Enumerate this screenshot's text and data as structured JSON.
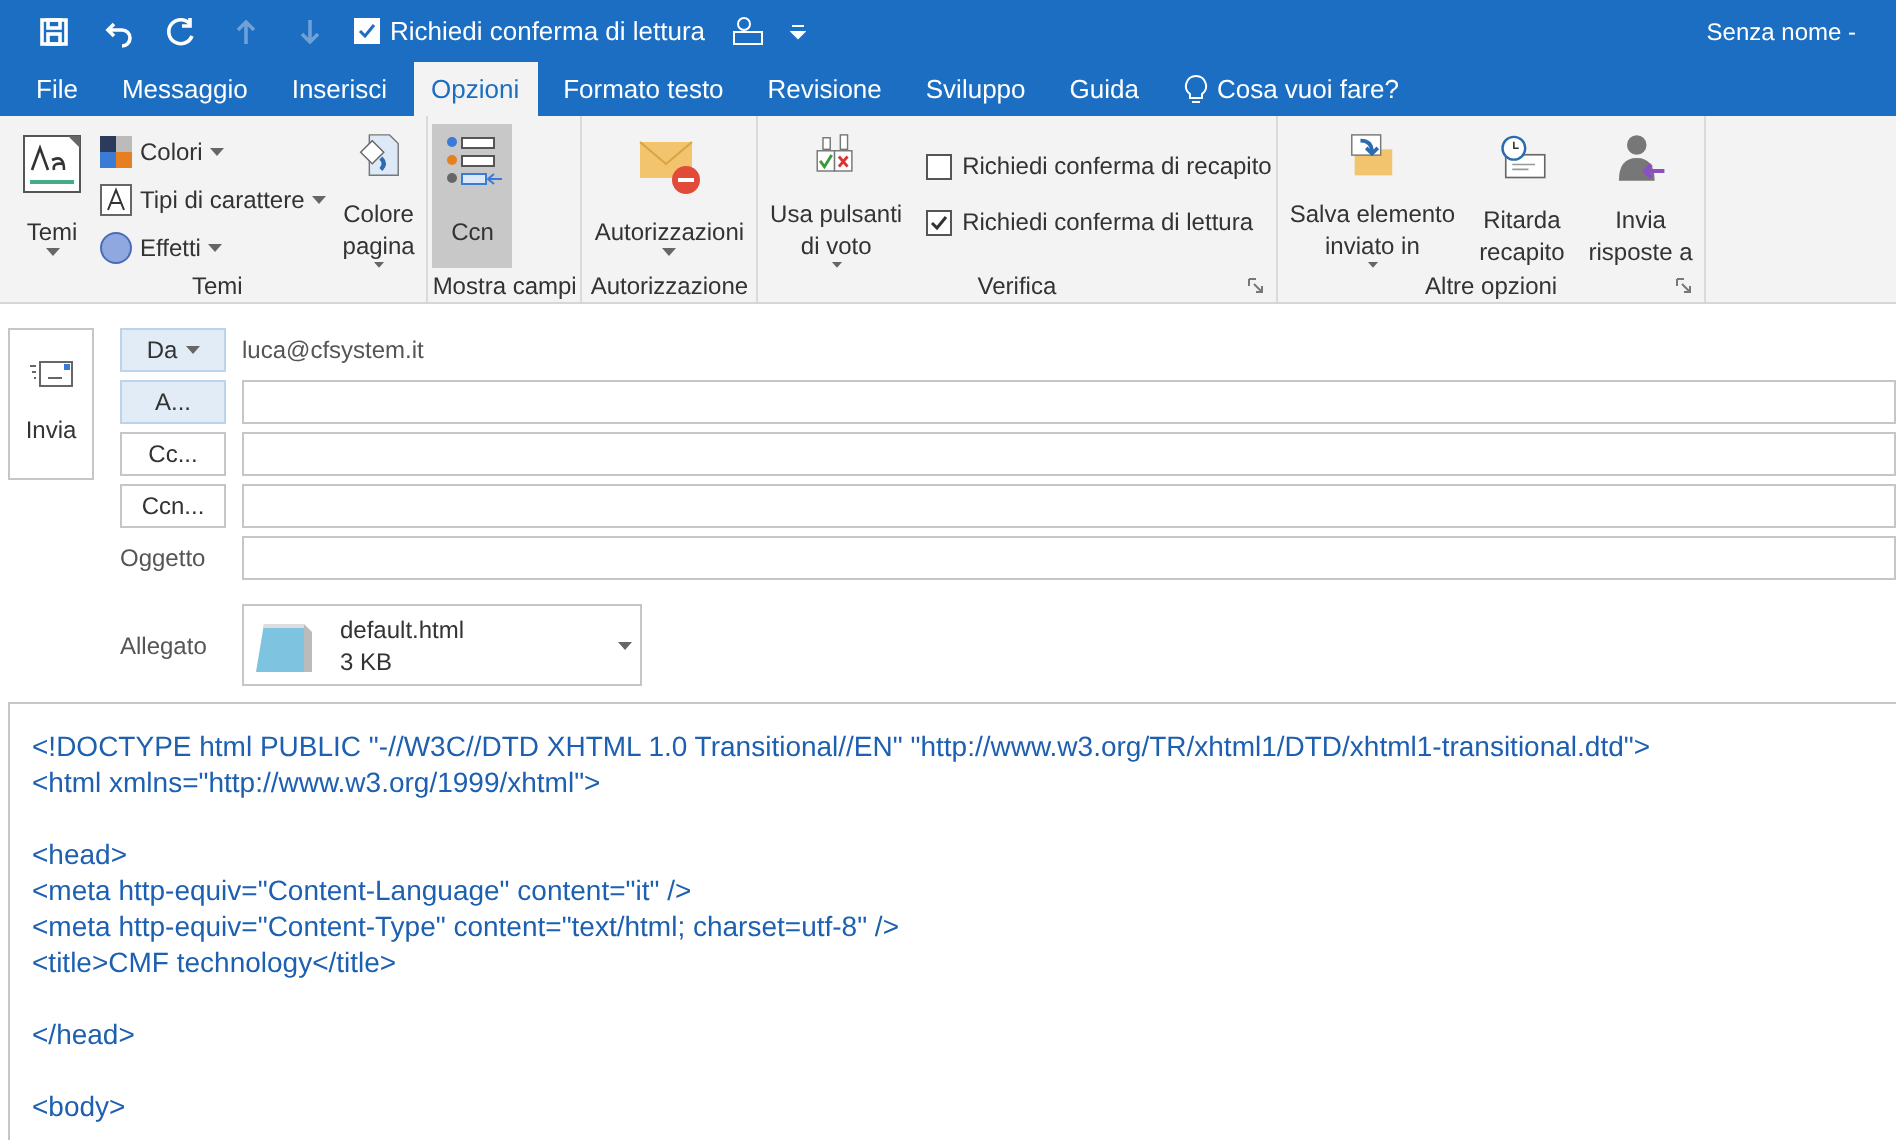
{
  "quick_access": [
    {
      "kind": "save",
      "disabled": false
    },
    {
      "kind": "undo",
      "disabled": false
    },
    {
      "kind": "redo",
      "disabled": false
    },
    {
      "kind": "up",
      "disabled": true
    },
    {
      "kind": "down",
      "disabled": true
    }
  ],
  "read_receipt": {
    "label": "Richiedi conferma di lettura",
    "checked": true
  },
  "window_title": "Senza nome -",
  "tabs": [
    {
      "label": "File",
      "selected": false
    },
    {
      "label": "Messaggio",
      "selected": false
    },
    {
      "label": "Inserisci",
      "selected": false
    },
    {
      "label": "Opzioni",
      "selected": true
    },
    {
      "label": "Formato testo",
      "selected": false
    },
    {
      "label": "Revisione",
      "selected": false
    },
    {
      "label": "Sviluppo",
      "selected": false
    },
    {
      "label": "Guida",
      "selected": false
    }
  ],
  "tell_me": "Cosa vuoi fare?",
  "ribbon": [
    {
      "label": "Temi",
      "launcher": false,
      "items": [
        {
          "kind": "large",
          "lines": [
            "Temi"
          ],
          "dropdown": true,
          "pressed": false
        },
        {
          "kind": "stack",
          "items": [
            {
              "label": "Colori",
              "dropdown": true
            },
            {
              "label": "Tipi di carattere",
              "dropdown": true
            },
            {
              "label": "Effetti",
              "dropdown": true
            }
          ]
        },
        {
          "kind": "large",
          "lines": [
            "Colore",
            "pagina"
          ],
          "dropdown": true,
          "pressed": false
        }
      ]
    },
    {
      "label": "Mostra campi",
      "launcher": false,
      "items": [
        {
          "kind": "large",
          "lines": [
            "Ccn"
          ],
          "dropdown": false,
          "pressed": true
        }
      ]
    },
    {
      "label": "Autorizzazione",
      "launcher": false,
      "items": [
        {
          "kind": "large",
          "lines": [
            "Autorizzazioni"
          ],
          "dropdown": true,
          "pressed": false
        }
      ]
    },
    {
      "label": "Verifica",
      "launcher": true,
      "items": [
        {
          "kind": "large",
          "lines": [
            "Usa pulsanti",
            "di voto"
          ],
          "dropdown": true,
          "pressed": false
        },
        {
          "kind": "checks",
          "items": [
            {
              "label": "Richiedi conferma di recapito",
              "checked": false
            },
            {
              "label": "Richiedi conferma di lettura",
              "checked": true
            }
          ]
        }
      ]
    },
    {
      "label": "Altre opzioni",
      "launcher": true,
      "items": [
        {
          "kind": "large",
          "lines": [
            "Salva elemento",
            "inviato in"
          ],
          "dropdown": true,
          "pressed": false
        },
        {
          "kind": "large",
          "lines": [
            "Ritarda",
            "recapito"
          ],
          "dropdown": false,
          "pressed": false
        },
        {
          "kind": "large",
          "lines": [
            "Invia",
            "risposte a"
          ],
          "dropdown": false,
          "pressed": false
        }
      ]
    }
  ],
  "send_button": "Invia",
  "from": {
    "button": "Da",
    "value": "luca@cfsystem.it"
  },
  "recipients": [
    {
      "button": "A...",
      "highlighted": true
    },
    {
      "button": "Cc...",
      "highlighted": false
    },
    {
      "button": "Ccn...",
      "highlighted": false
    }
  ],
  "subject_label": "Oggetto",
  "attachment": {
    "label": "Allegato",
    "name": "default.html",
    "size": "3 KB"
  },
  "body": [
    [
      "<!DOCTYPE html PUBLIC \"-//W3C//DTD XHTML 1.0 Transitional//EN\" \"http://www.w3.org/TR/xhtml1/DTD/xhtml1-transitional.dtd\">",
      "<html xmlns=\"http://www.w3.org/1999/xhtml\">"
    ],
    [
      "<head>",
      "<meta http-equiv=\"Content-Language\" content=\"it\" />",
      "<meta http-equiv=\"Content-Type\" content=\"text/html; charset=utf-8\" />",
      "<title>CMF technology</title>"
    ],
    [
      "</head>"
    ],
    [
      "<body>"
    ]
  ]
}
